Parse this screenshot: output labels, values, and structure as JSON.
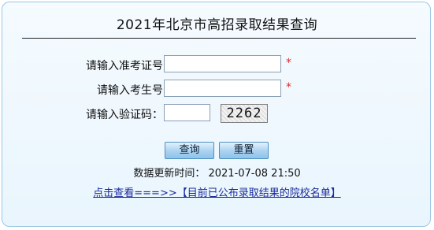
{
  "page": {
    "title": "2021年北京市高招录取结果查询"
  },
  "form": {
    "exam_id_label": "请输入准考证号",
    "exam_id_value": "",
    "student_id_label": "请输入考生号",
    "student_id_value": "",
    "captcha_label": "请输入验证码：",
    "captcha_value": "",
    "captcha_code": "2262",
    "required_mark": "*"
  },
  "buttons": {
    "query_label": "查询",
    "reset_label": "重置"
  },
  "footer": {
    "updated_text": "数据更新时间： 2021-07-08 21:50",
    "link_text": "点击查看===>>【目前已公布录取结果的院校名单】"
  },
  "colors": {
    "panel_border": "#9cc7e3",
    "panel_bg": "#eef7fd",
    "required": "#e0262c",
    "link": "#1a2b9c",
    "button_top": "#e3f2fc",
    "button_bottom": "#8fc3ea"
  }
}
